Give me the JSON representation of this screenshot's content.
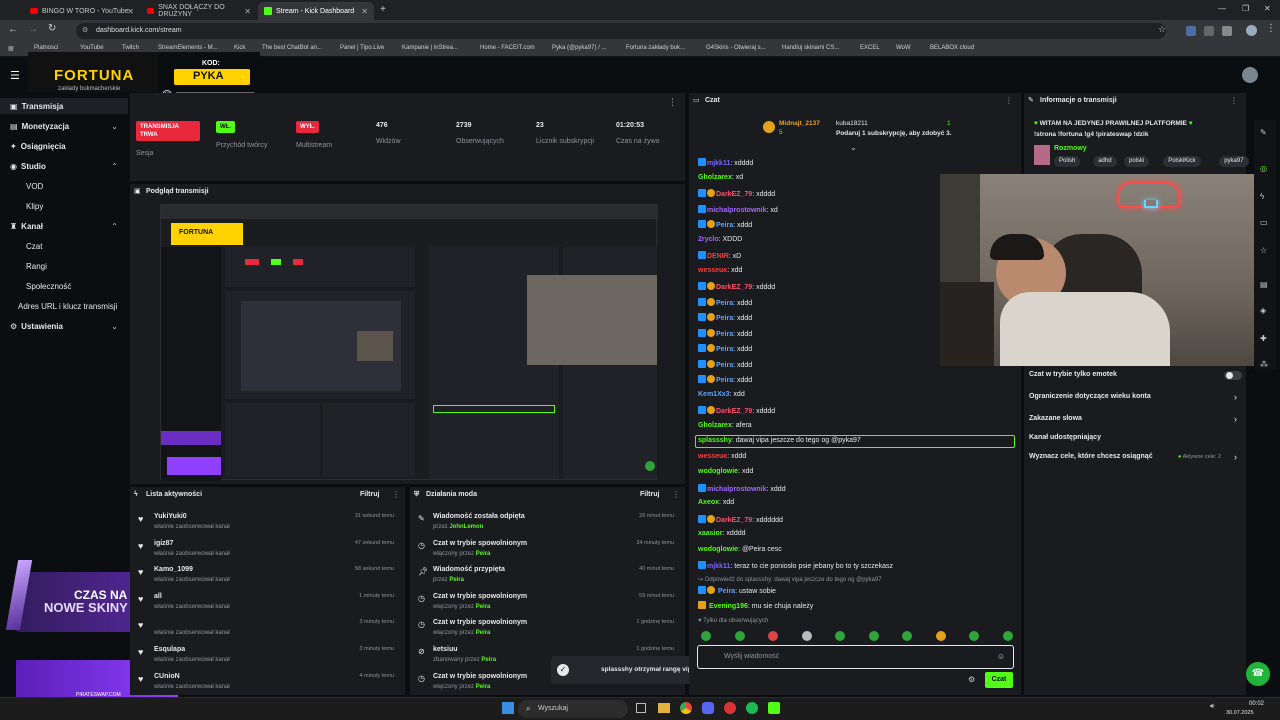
{
  "browser": {
    "tabs": [
      {
        "label": "BINGO W TORO - YouTube",
        "kind": "yt"
      },
      {
        "label": "SNAX DOŁĄCZY DO DRUŻYNY",
        "kind": "yt"
      },
      {
        "label": "Stream - Kick Dashboard",
        "kind": "kick"
      }
    ],
    "url": "dashboard.kick.com/stream",
    "bookmarks": [
      "Platnosci",
      "YouTube",
      "Twitch",
      "StreamElements - M...",
      "Kick",
      "The best ChatBot an...",
      "Panel | Tipo.Live",
      "Kampanie | inStrea...",
      "Home - FACEIT.com",
      "Pyka (@pyka97) / ...",
      "Fortuna zakłady buk...",
      "G4Skins - Otwieraj s...",
      "Handluj skinami CS...",
      "EXCEL",
      "WoW",
      "BELABOX cloud"
    ]
  },
  "overlay": {
    "sponsor_name": "FORTUNA",
    "sponsor_tagline": "zakłady bukmacherskie",
    "code_label": "KOD:",
    "code_value": "PYKA",
    "promo_line1": "CZAS NA",
    "promo_line2": "NOWE SKINY",
    "promo_site": "PIRATESWAP.COM"
  },
  "sidebar": {
    "items": [
      {
        "label": "Transmisja",
        "level": 0
      },
      {
        "label": "Monetyzacja",
        "level": 0
      },
      {
        "label": "Osiągnięcia",
        "level": 0
      },
      {
        "label": "Studio",
        "level": 0
      },
      {
        "label": "VOD",
        "level": 1
      },
      {
        "label": "Klipy",
        "level": 1
      },
      {
        "label": "Kanał",
        "level": 0
      },
      {
        "label": "Czat",
        "level": 1
      },
      {
        "label": "Rangi",
        "level": 1
      },
      {
        "label": "Społeczność",
        "level": 1
      },
      {
        "label": "Adres URL i klucz transmisji",
        "level": 1
      },
      {
        "label": "Ustawienia",
        "level": 0
      }
    ]
  },
  "stats": [
    {
      "value": "TRANSMISJA TRWA",
      "label": "Sesja",
      "badge": "red"
    },
    {
      "value": "WŁ.",
      "label": "Przychód twórcy",
      "badge": "green"
    },
    {
      "value": "WYŁ.",
      "label": "Multistream",
      "badge": "red"
    },
    {
      "value": "476",
      "label": "Widzów"
    },
    {
      "value": "2739",
      "label": "Obserwujących"
    },
    {
      "value": "23",
      "label": "Licznik subskrypcji"
    },
    {
      "value": "01:20:53",
      "label": "Czas na żywo"
    }
  ],
  "preview": {
    "title": "Podgląd transmisji"
  },
  "activity": {
    "title": "Lista aktywności",
    "filter": "Filtruj",
    "items": [
      {
        "name": "YukiYuki0",
        "sub": "właśnie zaobserwował kanał",
        "time": "31 sekund temu"
      },
      {
        "name": "igiz87",
        "sub": "właśnie zaobserwował kanał",
        "time": "47 sekund temu"
      },
      {
        "name": "Kamo_1099",
        "sub": "właśnie zaobserwował kanał",
        "time": "58 sekund temu"
      },
      {
        "name": "all",
        "sub": "właśnie zaobserwował kanał",
        "time": "1 minutę temu"
      },
      {
        "name": "",
        "sub": "właśnie zaobserwował kanał",
        "time": "3 minuty temu"
      },
      {
        "name": "Esqulapa",
        "sub": "właśnie zaobserwował kanał",
        "time": "3 minuty temu"
      },
      {
        "name": "CUnioN",
        "sub": "właśnie zaobserwował kanał",
        "time": "4 minuty temu"
      }
    ]
  },
  "modactions": {
    "title": "Działania moda",
    "filter": "Filtruj",
    "items": [
      {
        "title": "Wiadomość została odpięta",
        "by_prefix": "przez",
        "by": "JohnLemon",
        "time": "26 minut temu"
      },
      {
        "title": "Czat w trybie spowolnionym",
        "by_prefix": "włączony przez",
        "by": "Peira",
        "time": "34 minuty temu"
      },
      {
        "title": "Wiadomość przypięta",
        "by_prefix": "przez",
        "by": "Peira",
        "time": "40 minut temu"
      },
      {
        "title": "Czat w trybie spowolnionym",
        "by_prefix": "włączony przez",
        "by": "Peira",
        "time": "59 minut temu"
      },
      {
        "title": "Czat w trybie spowolnionym",
        "by_prefix": "włączony przez",
        "by": "Peira",
        "time": "1 godzinę temu"
      },
      {
        "title": "ketsiuu",
        "by_prefix": "zbanowany przez",
        "by": "Peira",
        "time": "1 godzinę temu"
      },
      {
        "title": "Czat w trybie spowolnionym",
        "by_prefix": "włączony przez",
        "by": "Peira",
        "time": "1 godzinę temu"
      }
    ]
  },
  "toast": "splassshy otrzymał rangę vip!",
  "chat": {
    "title": "Czat",
    "pinned_user": "Midnajt_2137",
    "pinned_sub_count": "5",
    "sub_user": "kuba18211",
    "sub_count": "1",
    "sub_text": "Podaruj 1 subskrypcję, aby zdobyć 3.",
    "messages": [
      {
        "user": "mjkk11",
        "color": "#7b61ff",
        "text": "xdddd",
        "badges": 1
      },
      {
        "user": "Gholzarex",
        "color": "#53fc18",
        "text": "xd",
        "badges": 0
      },
      {
        "user": "DarkEZ_79",
        "color": "#ff4d6d",
        "text": "xdddd",
        "badges": 2
      },
      {
        "user": "michalprostownik",
        "color": "#a066ff",
        "text": "xd",
        "badges": 1
      },
      {
        "user": "Peira",
        "color": "#5ba3ff",
        "text": "xddd",
        "badges": 2
      },
      {
        "user": "2ryclo",
        "color": "#a066ff",
        "text": "XDDD",
        "badges": 0
      },
      {
        "user": "DENIR",
        "color": "#ff3b3b",
        "text": "xD",
        "badges": 1
      },
      {
        "user": "wesseux",
        "color": "#ff3b3b",
        "text": "xdd",
        "badges": 0
      },
      {
        "user": "DarkEZ_79",
        "color": "#ff4d6d",
        "text": "xdddd",
        "badges": 2
      },
      {
        "user": "Peira",
        "color": "#5ba3ff",
        "text": "xddd",
        "badges": 2
      },
      {
        "user": "Peira",
        "color": "#5ba3ff",
        "text": "xddd",
        "badges": 2
      },
      {
        "user": "Peira",
        "color": "#5ba3ff",
        "text": "xddd",
        "badges": 2
      },
      {
        "user": "Peira",
        "color": "#5ba3ff",
        "text": "xddd",
        "badges": 2
      },
      {
        "user": "Peira",
        "color": "#5ba3ff",
        "text": "xddd",
        "badges": 2
      },
      {
        "user": "Peira",
        "color": "#5ba3ff",
        "text": "xddd",
        "badges": 2
      },
      {
        "user": "Kem1Xx3",
        "color": "#5ba3ff",
        "text": "xdd",
        "badges": 0
      },
      {
        "user": "DarkEZ_79",
        "color": "#ff4d6d",
        "text": "xdddd",
        "badges": 2
      },
      {
        "user": "Gholzarex",
        "color": "#53fc18",
        "text": "afera",
        "badges": 0
      },
      {
        "user": "splassshy",
        "color": "#53fc18",
        "text": "dawaj vipa jeszcze do tego og @pyka97",
        "badges": 0,
        "highlight": true
      },
      {
        "user": "wesseux",
        "color": "#ff3b3b",
        "text": "xddd",
        "badges": 0
      },
      {
        "user": "wodoglowie",
        "color": "#53fc18",
        "text": "xdd",
        "badges": 0
      },
      {
        "user": "michalprostownik",
        "color": "#a066ff",
        "text": "xddd",
        "badges": 1
      },
      {
        "user": "Axeox",
        "color": "#53fc18",
        "text": "xdd",
        "badges": 0
      },
      {
        "user": "DarkEZ_79",
        "color": "#ff4d6d",
        "text": "xdddddd",
        "badges": 2
      },
      {
        "user": "xaasior",
        "color": "#53fc18",
        "text": "xdddd",
        "badges": 0
      },
      {
        "user": "wodoglowie",
        "color": "#53fc18",
        "text": "@Peira cesc",
        "badges": 0
      },
      {
        "user": "mjkk11",
        "color": "#7b61ff",
        "text": "teraz to cie poniosło psie jebany bo to ty szczekasz",
        "badges": 1
      }
    ],
    "reply_hint": "Odpowiedź do splassshy: dawaj vipa jeszcze do tego og @pyka97",
    "reply_msg": {
      "user": "Peira",
      "color": "#5ba3ff",
      "text": "ustaw sobie"
    },
    "last_msg": {
      "user": "Evening196",
      "color": "#53fc18",
      "text": "mu sie chuja należy"
    },
    "followers_only": "Tylko dla obserwujących",
    "input_placeholder": "Wyślij wiadomość",
    "send_label": "Czat"
  },
  "info": {
    "title": "Informacje o transmisji",
    "stream_title": "WITAM NA JEDYNEJ PRAWILNEJ PLATFORMIE",
    "stream_title2": "!strona !fortuna !g4 !pirateswap !dzik",
    "category": "Rozmowy",
    "tags": [
      "Polish",
      "adhd",
      "polski",
      "PolskiKick",
      "pyka97"
    ],
    "rows": [
      {
        "label": "Czat w trybie tylko emotek",
        "control": "toggle"
      },
      {
        "label": "Ograniczenie dotyczące wieku konta",
        "control": "chevron"
      },
      {
        "label": "Zakazane słowa",
        "control": "chevron"
      },
      {
        "label": "Kanał udostępniający",
        "control": "none"
      },
      {
        "label": "Wyznacz cele, które chcesz osiągnąć",
        "control": "chevron",
        "extra": "Aktywne cele: 2"
      }
    ]
  },
  "taskbar": {
    "search": "Wyszukaj",
    "time": "00:02",
    "date": "30.07.2025"
  },
  "colors": {
    "kick_green": "#53fc18",
    "panel": "#191b1f",
    "bg": "#0b0e11",
    "red": "#e8283c",
    "fortuna_yellow": "#ffd200"
  }
}
